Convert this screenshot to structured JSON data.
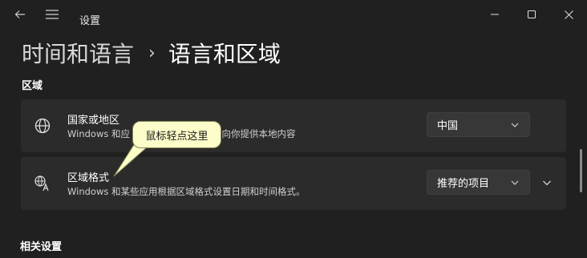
{
  "titlebar": {
    "app_title": "设置",
    "icons": [
      "back-arrow-icon",
      "hamburger-menu-icon",
      "minimize-icon",
      "maximize-icon",
      "close-icon"
    ]
  },
  "breadcrumb": {
    "parent": "时间和语言",
    "separator": "›",
    "current": "语言和区域"
  },
  "region_section": {
    "title": "区域",
    "country": {
      "icon": "globe-icon",
      "title": "国家或地区",
      "desc_left": "Windows 和应",
      "desc_right": "国家或地区向你提供本地内容",
      "selected": "中国"
    },
    "format": {
      "icon": "regional-format-icon",
      "title": "区域格式",
      "desc": "Windows 和某些应用根据区域格式设置日期和时间格式。",
      "selected": "推荐的项目"
    }
  },
  "tooltip": {
    "text": "鼠标轻点这里"
  },
  "related_section": {
    "title": "相关设置"
  },
  "colors": {
    "background": "#202020",
    "card": "#2b2b2b",
    "tooltip_bg": "#fdfdc9"
  }
}
